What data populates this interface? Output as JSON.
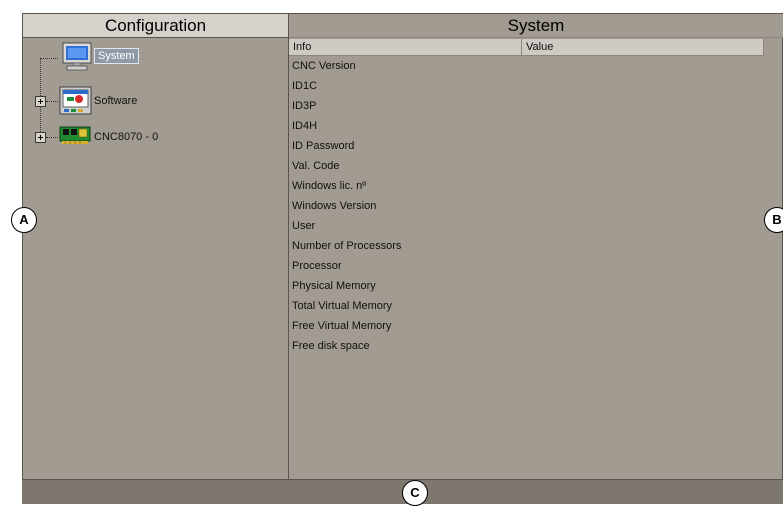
{
  "left_panel": {
    "title": "Configuration",
    "nodes": [
      {
        "label": "System",
        "icon": "monitor-icon",
        "selected": true
      },
      {
        "label": "Software",
        "icon": "software-screen-icon",
        "expandable": true
      },
      {
        "label": "CNC8070 - 0",
        "icon": "circuit-board-icon",
        "expandable": true
      }
    ]
  },
  "right_panel": {
    "title": "System",
    "columns": [
      "Info",
      "Value"
    ],
    "rows": [
      {
        "info": "CNC Version",
        "value": ""
      },
      {
        "info": "ID1C",
        "value": ""
      },
      {
        "info": "ID3P",
        "value": ""
      },
      {
        "info": "ID4H",
        "value": ""
      },
      {
        "info": "ID Password",
        "value": ""
      },
      {
        "info": "Val. Code",
        "value": ""
      },
      {
        "info": "Windows lic. nº",
        "value": ""
      },
      {
        "info": "Windows Version",
        "value": ""
      },
      {
        "info": "User",
        "value": ""
      },
      {
        "info": "Number of Processors",
        "value": ""
      },
      {
        "info": "Processor",
        "value": ""
      },
      {
        "info": "Physical Memory",
        "value": ""
      },
      {
        "info": "Total Virtual Memory",
        "value": ""
      },
      {
        "info": "Free Virtual Memory",
        "value": ""
      },
      {
        "info": "Free disk space",
        "value": ""
      }
    ]
  },
  "callouts": [
    "A",
    "B",
    "C"
  ],
  "colors": {
    "panel_bg": "#a29b92",
    "title_bg": "#d6d1ca",
    "frame_bg": "#7e776f",
    "selection_bg": "#8f99a8"
  }
}
